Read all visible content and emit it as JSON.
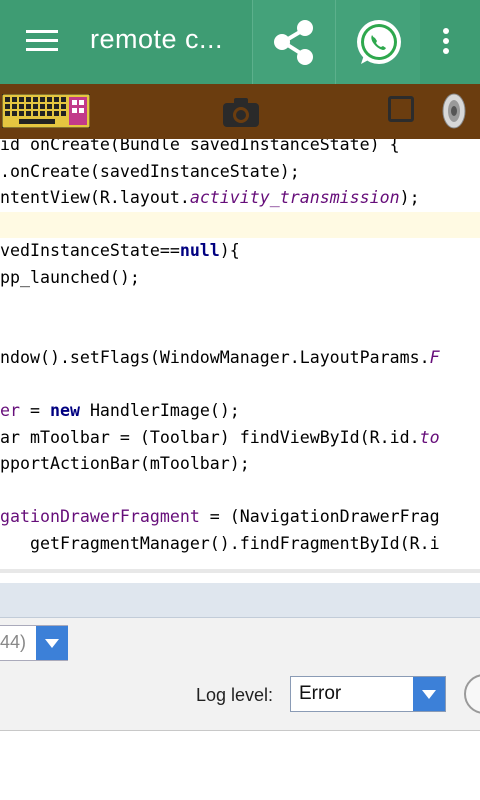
{
  "appbar": {
    "title": "remote c...",
    "menu_icon": "hamburger-menu-icon",
    "share_icon": "share-icon",
    "whatsapp_icon": "whatsapp-icon",
    "more_icon": "more-vert-icon"
  },
  "remote_toolbar": {
    "keyboard_icon": "keyboard-icon",
    "camera_icon": "camera-icon",
    "square_icon": "square-icon",
    "speaker_icon": "speaker-icon"
  },
  "code_lines": [
    [
      {
        "t": "id onCreate(Bundle savedInstanceState) {",
        "c": ""
      }
    ],
    [
      {
        "t": ".onCreate(savedInstanceState);",
        "c": ""
      }
    ],
    [
      {
        "t": "ntentView(R.layout.",
        "c": ""
      },
      {
        "t": "activity_transmission",
        "c": "field"
      },
      {
        "t": ");",
        "c": ""
      }
    ],
    [
      {
        "t": "",
        "c": ""
      }
    ],
    [
      {
        "t": "vedInstanceState==",
        "c": ""
      },
      {
        "t": "null",
        "c": "kw"
      },
      {
        "t": "){",
        "c": ""
      }
    ],
    [
      {
        "t": "pp_launched();",
        "c": ""
      }
    ],
    [
      {
        "t": "",
        "c": ""
      }
    ],
    [
      {
        "t": "",
        "c": ""
      }
    ],
    [
      {
        "t": "ndow().setFlags(WindowManager.LayoutParams.",
        "c": ""
      },
      {
        "t": "F",
        "c": "field"
      }
    ],
    [
      {
        "t": "",
        "c": ""
      }
    ],
    [
      {
        "t": "er",
        "c": "fld"
      },
      {
        "t": " = ",
        "c": ""
      },
      {
        "t": "new",
        "c": "kw"
      },
      {
        "t": " HandlerImage();",
        "c": ""
      }
    ],
    [
      {
        "t": "ar mToolbar = (Toolbar) findViewById(R.id.",
        "c": ""
      },
      {
        "t": "to",
        "c": "field"
      }
    ],
    [
      {
        "t": "pportActionBar(mToolbar);",
        "c": ""
      }
    ],
    [
      {
        "t": "",
        "c": ""
      }
    ],
    [
      {
        "t": "gationDrawerFragment",
        "c": "fld"
      },
      {
        "t": " = (NavigationDrawerFrag",
        "c": ""
      }
    ],
    [
      {
        "t": "   getFragmentManager().findFragmentById(R.i",
        "c": ""
      }
    ]
  ],
  "logcat": {
    "device_value": "44)",
    "log_level_label": "Log level:",
    "log_level_value": "Error",
    "dropdown_icon": "chevron-down-icon",
    "round_button_icon": "circle-button-icon"
  }
}
